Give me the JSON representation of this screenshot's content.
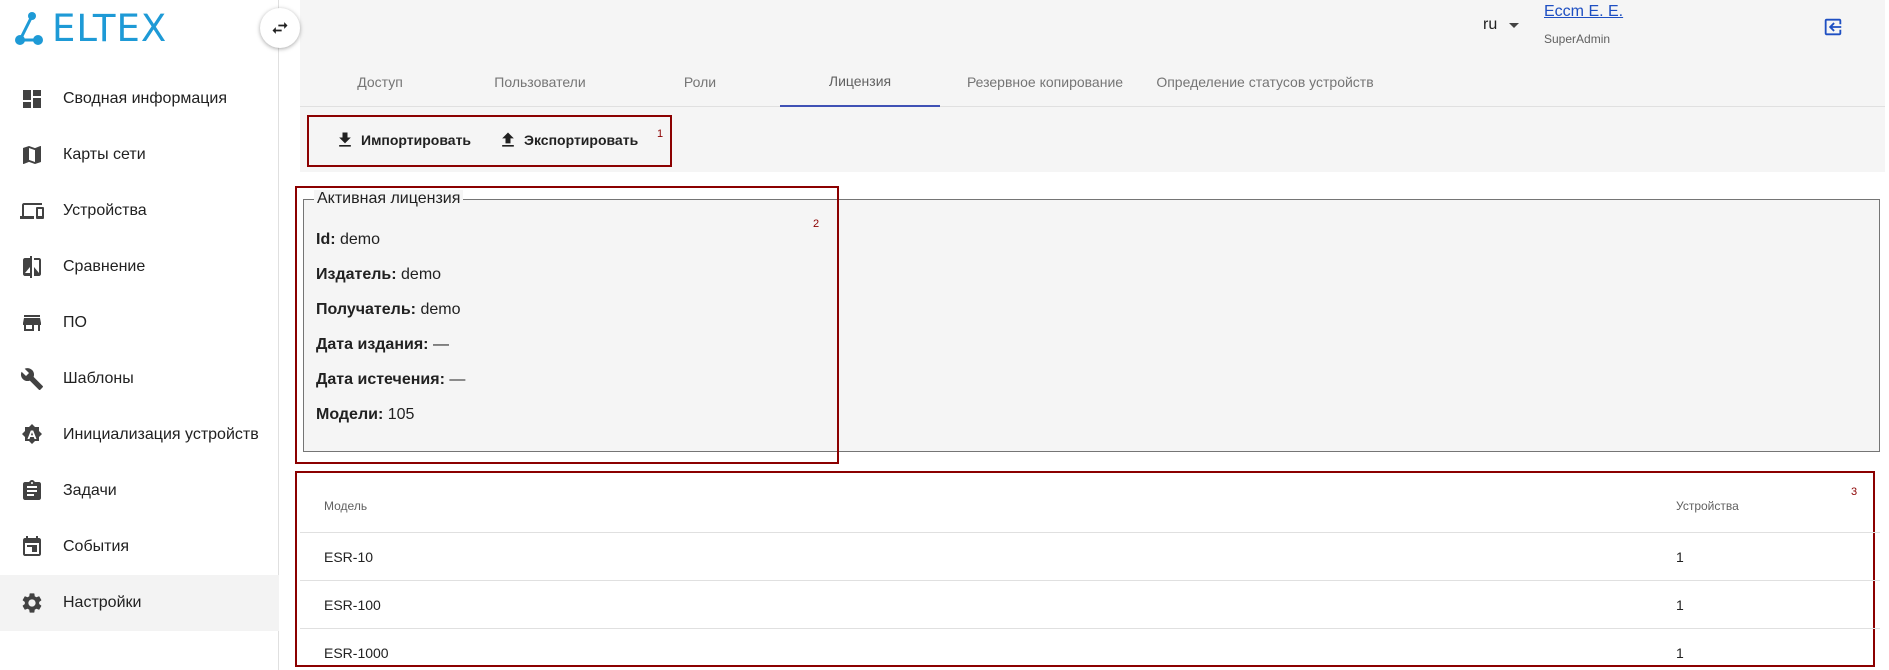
{
  "brand": {
    "name": "ELTEX",
    "color": "#1e9ad6"
  },
  "sidebar": {
    "items": [
      {
        "label": "Сводная информация",
        "icon": "dashboard-icon"
      },
      {
        "label": "Карты сети",
        "icon": "map-icon"
      },
      {
        "label": "Устройства",
        "icon": "devices-icon"
      },
      {
        "label": "Сравнение",
        "icon": "compare-icon"
      },
      {
        "label": "ПО",
        "icon": "store-icon"
      },
      {
        "label": "Шаблоны",
        "icon": "wrench-icon"
      },
      {
        "label": "Инициализация устройств",
        "icon": "init-icon"
      },
      {
        "label": "Задачи",
        "icon": "clipboard-icon"
      },
      {
        "label": "События",
        "icon": "events-icon"
      },
      {
        "label": "Настройки",
        "icon": "gear-icon",
        "active": true
      }
    ]
  },
  "header": {
    "language": "ru",
    "user_name": "Eccm E. E.",
    "user_role": "SuperAdmin"
  },
  "tabs": [
    {
      "label": "Доступ"
    },
    {
      "label": "Пользователи"
    },
    {
      "label": "Роли"
    },
    {
      "label": "Лицензия",
      "active": true
    },
    {
      "label": "Резервное копирование"
    },
    {
      "label": "Определение статусов устройств"
    }
  ],
  "toolbar": {
    "import_label": "Импортировать",
    "export_label": "Экспортировать"
  },
  "markers": {
    "one": "1",
    "two": "2",
    "three": "3"
  },
  "license": {
    "legend": "Активная лицензия",
    "fields": [
      {
        "label": "Id:",
        "value": "demo"
      },
      {
        "label": "Издатель:",
        "value": "demo"
      },
      {
        "label": "Получатель:",
        "value": "demo"
      },
      {
        "label": "Дата издания:",
        "value": "—"
      },
      {
        "label": "Дата истечения:",
        "value": "—"
      },
      {
        "label": "Модели:",
        "value": "105"
      }
    ]
  },
  "table": {
    "headers": {
      "model": "Модель",
      "devices": "Устройства"
    },
    "rows": [
      {
        "model": "ESR-10",
        "devices": "1"
      },
      {
        "model": "ESR-100",
        "devices": "1"
      },
      {
        "model": "ESR-1000",
        "devices": "1"
      }
    ]
  },
  "colors": {
    "accent": "#3f51b5",
    "highlight_border": "#8b0000",
    "link": "#1e4fc2"
  }
}
